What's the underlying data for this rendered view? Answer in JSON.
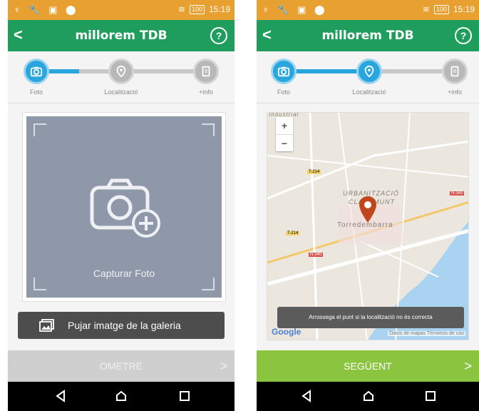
{
  "status_bar": {
    "left_icons": "♆ 🔧 ▣ ⬤",
    "battery": "100",
    "time": "15:19"
  },
  "app": {
    "title": "millorem TDB",
    "help": "?",
    "back_icon": "chevron-left-icon"
  },
  "steps": [
    {
      "label": "Foto",
      "icon": "camera-icon"
    },
    {
      "label": "Localització",
      "icon": "location-pin-icon"
    },
    {
      "label": "+info",
      "icon": "clipboard-icon"
    }
  ],
  "screen1": {
    "progress_fraction": 0.5,
    "capture_label": "Capturar Foto",
    "gallery_label": "Pujar imatge de la galeria",
    "skip_label": "OMETRE"
  },
  "screen2": {
    "progress_fraction": 1.0,
    "map_labels": {
      "place1": "Industrial",
      "place2": "URBANITZACIÓ",
      "place3": "CLARAMUNT",
      "town": "Torredembarra",
      "road1": "T-214",
      "road2": "T-214",
      "road3": "N-340",
      "road4": "N-340"
    },
    "zoom_in": "+",
    "zoom_out": "−",
    "toast": "Arrossega el punt si la localització no és correcta",
    "google": "Google",
    "credits": "Datos de mapas  Términos de uso",
    "next_label": "SEGÜENT"
  },
  "colors": {
    "status": "#e8a030",
    "appbar": "#1f9d5c",
    "accent": "#2aa6de",
    "next": "#8bc53f",
    "pin": "#c0471c"
  }
}
